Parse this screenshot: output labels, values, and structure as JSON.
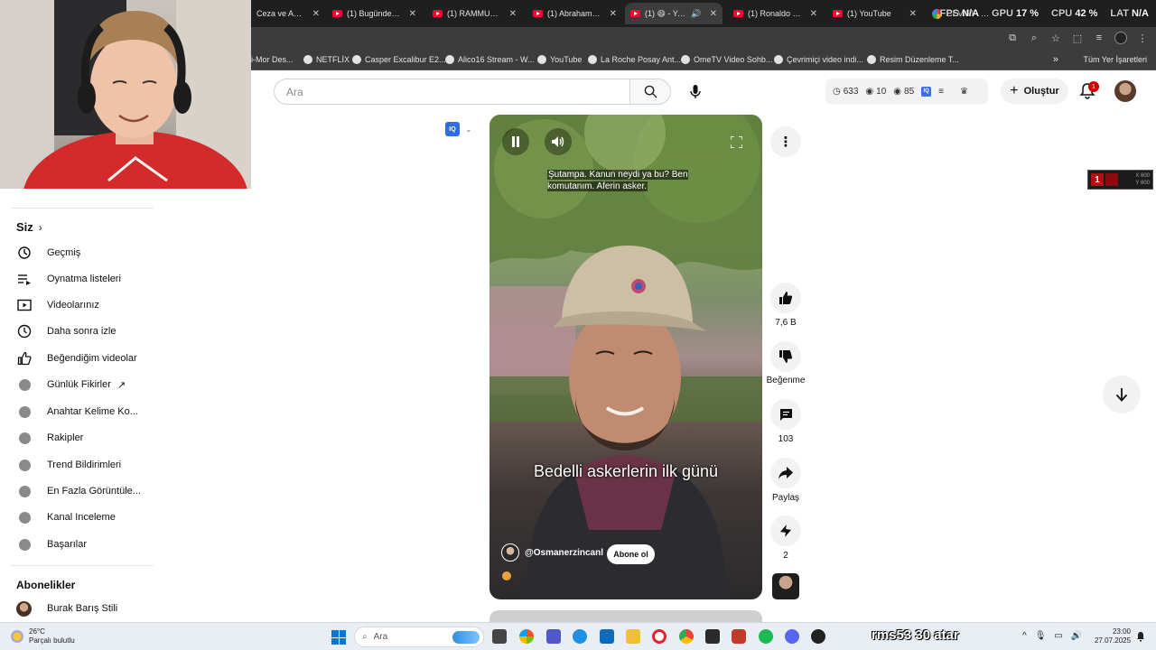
{
  "browser": {
    "tabs": [
      {
        "label": "Ceza ve Arem",
        "icon": "youtube-icon"
      },
      {
        "label": "(1) Bugünde poizi",
        "icon": "youtube-icon"
      },
      {
        "label": "(1) RAMMUS53 \"l",
        "icon": "youtube-icon"
      },
      {
        "label": "(1) Abraham Beşli",
        "icon": "youtube-icon"
      },
      {
        "label": "(1) 😄 - YouTu",
        "icon": "youtube-icon",
        "active": true
      },
      {
        "label": "(1) Ronaldo Jr Rev",
        "icon": "youtube-icon"
      },
      {
        "label": "(1) YouTube",
        "icon": "youtube-icon"
      },
      {
        "label": "CEVIRI - Google",
        "icon": "google-icon"
      }
    ],
    "perf": {
      "fps_label": "FPS",
      "fps_value": "N/A",
      "gpu_label": "GPU",
      "gpu_value": "17 %",
      "cpu_label": "CPU",
      "cpu_value": "42 %",
      "lat_label": "LAT",
      "lat_value": "N/A"
    },
    "bookmarks": [
      "i-Mor Des...",
      "NETFLİX",
      "Casper Excalibur E2...",
      "Alico16 Stream - W...",
      "YouTube",
      "La Roche Posay Ant...",
      "OmeTV Video Sohb...",
      "Çevrimiçi video indi...",
      "Resim Düzenleme T..."
    ],
    "bookmarks_all": "Tüm Yer İşaretleri"
  },
  "youtube": {
    "search_placeholder": "Ara",
    "stats": {
      "time": "633",
      "views1": "10",
      "views2": "85"
    },
    "create_label": "Oluştur",
    "notif_count": "1"
  },
  "sidebar": {
    "you_heading": "Siz",
    "items": [
      {
        "label": "Geçmiş",
        "icon": "history-icon"
      },
      {
        "label": "Oynatma listeleri",
        "icon": "playlist-icon"
      },
      {
        "label": "Videolarınız",
        "icon": "your-videos-icon"
      },
      {
        "label": "Daha sonra izle",
        "icon": "watch-later-icon"
      },
      {
        "label": "Beğendiğim videolar",
        "icon": "liked-icon"
      }
    ],
    "ext_items": [
      {
        "label": "Günlük Fikirler",
        "external": true
      },
      {
        "label": "Anahtar Kelime Ko..."
      },
      {
        "label": "Rakipler"
      },
      {
        "label": "Trend Bildirimleri"
      },
      {
        "label": "En Fazla Görüntüle..."
      },
      {
        "label": "Kanal Inceleme"
      },
      {
        "label": "Başarılar"
      }
    ],
    "subs_heading": "Abonelikler",
    "subs": [
      {
        "label": "Burak Barış Stili"
      }
    ]
  },
  "short": {
    "caption": "Şutampa. Kanun neydi ya bu? Ben komutanım. Aferin asker.",
    "title": "Bedelli askerlerin ilk günü",
    "channel": "@Osmanerzincanl",
    "subscribe_label": "Abone ol",
    "likes": "7,6 B",
    "dislike_label": "Beğenme",
    "comments": "103",
    "share_label": "Paylaş",
    "remix": "2"
  },
  "overlay": {
    "x_label": "X 600",
    "y_label": "Y 600",
    "badge": "1"
  },
  "taskbar": {
    "temp": "26°C",
    "weather_desc": "Parçalı bulutlu",
    "search_placeholder": "Ara",
    "stream_text": "rms53 30 atar",
    "time": "23:00",
    "date": "27.07.2025"
  }
}
